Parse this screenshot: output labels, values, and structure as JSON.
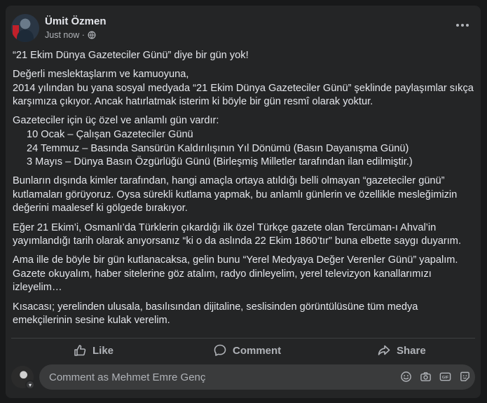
{
  "post": {
    "author": "Ümit Özmen",
    "time": "Just now ·",
    "paragraphs": [
      "“21 Ekim Dünya Gazeteciler Günü” diye bir gün yok!",
      "Değerli meslektaşlarım ve kamuoyuna,",
      "2014 yılından bu yana sosyal medyada “21 Ekim Dünya Gazeteciler Günü” şeklinde paylaşımlar sıkça karşımıza çıkıyor. Ancak hatırlatmak isterim ki böyle bir gün resmî olarak yoktur.",
      "Gazeteciler için üç özel ve anlamlı gün vardır:",
      "10 Ocak – Çalışan Gazeteciler Günü",
      "24 Temmuz – Basında Sansürün Kaldırılışının Yıl Dönümü (Basın Dayanışma Günü)",
      "3 Mayıs – Dünya Basın Özgürlüğü Günü (Birleşmiş Milletler tarafından ilan edilmiştir.)",
      "Bunların dışında kimler tarafından, hangi amaçla ortaya atıldığı belli olmayan “gazeteciler günü” kutlamaları görüyoruz. Oysa sürekli kutlama yapmak, bu anlamlı günlerin ve özellikle mesleğimizin değerini maalesef ki gölgede bırakıyor.",
      "Eğer 21 Ekim’i, Osmanlı’da Türklerin çıkardığı ilk özel Türkçe gazete olan Tercüman-ı Ahval’in yayımlandığı tarih olarak anıyorsanız “ki o da aslında 22 Ekim 1860’tır” buna elbette saygı duyarım.",
      "Ama ille de böyle bir gün kutlanacaksa, gelin bunu “Yerel Medyaya Değer Verenler Günü” yapalım. Gazete okuyalım, haber sitelerine göz atalım, radyo dinleyelim, yerel televizyon kanallarımızı izleyelim…",
      "Kısacası; yerelinden ulusala, basılısından dijitaline, seslisinden görüntülüsüne tüm medya emekçilerinin sesine kulak verelim."
    ]
  },
  "actions": {
    "like": "Like",
    "comment": "Comment",
    "share": "Share"
  },
  "comment_input": {
    "placeholder": "Comment as Mehmet Emre Genç"
  },
  "icons": {
    "privacy": "globe-icon",
    "more": "more-options-icon",
    "like": "thumbs-up-icon",
    "comment": "comment-bubble-icon",
    "share": "share-arrow-icon",
    "emoji": "emoji-icon",
    "camera": "camera-icon",
    "gif": "gif-icon",
    "sticker": "sticker-icon"
  },
  "colors": {
    "background": "#18191a",
    "card": "#242526",
    "text": "#e4e6eb",
    "secondary_text": "#b0b3b8",
    "input": "#3a3b3c"
  }
}
